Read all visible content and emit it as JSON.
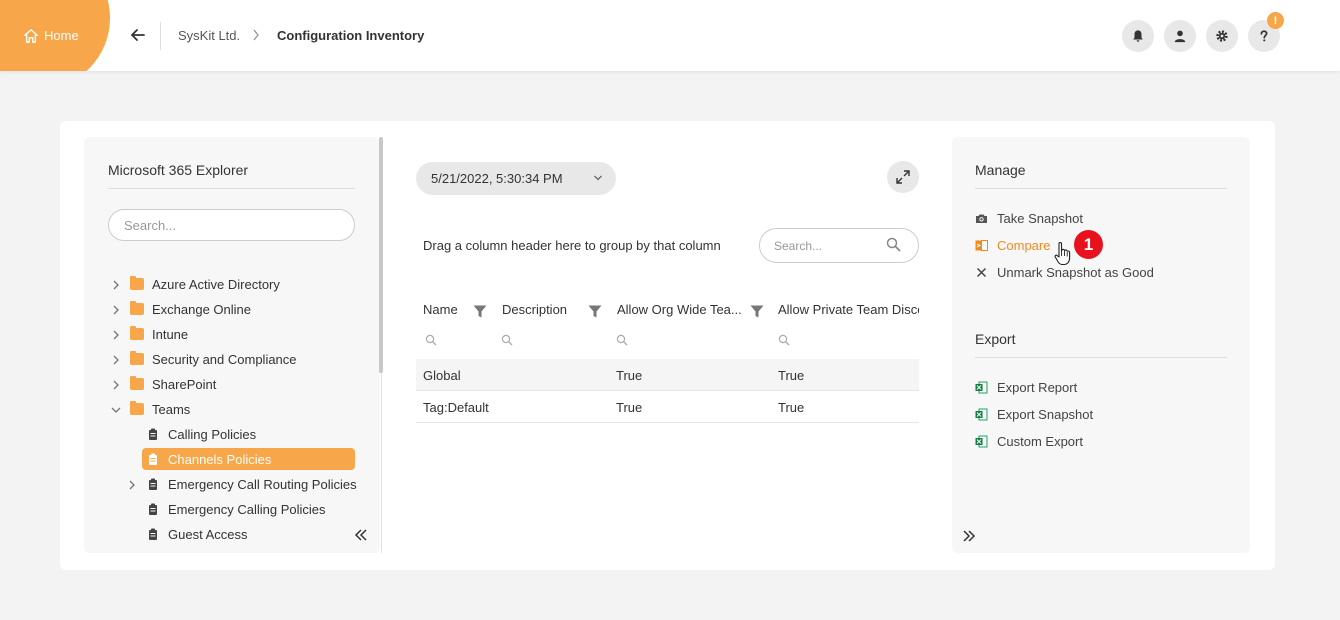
{
  "topbar": {
    "home_label": "Home",
    "breadcrumb": [
      "SysKit Ltd.",
      "Configuration Inventory"
    ],
    "help_badge": "!",
    "accent_color": "#f7a64a"
  },
  "left_panel": {
    "title": "Microsoft 365 Explorer",
    "search_placeholder": "Search...",
    "tree": [
      {
        "label": "Azure Active Directory",
        "icon": "folder-icon",
        "expandable": true
      },
      {
        "label": "Exchange Online",
        "icon": "folder-icon",
        "expandable": true
      },
      {
        "label": "Intune",
        "icon": "folder-icon",
        "expandable": true
      },
      {
        "label": "Security and Compliance",
        "icon": "folder-icon",
        "expandable": true
      },
      {
        "label": "SharePoint",
        "icon": "folder-icon",
        "expandable": true
      },
      {
        "label": "Teams",
        "icon": "folder-icon",
        "expanded": true
      },
      {
        "label": "Calling Policies",
        "icon": "clipboard-icon"
      },
      {
        "label": "Channels Policies",
        "icon": "clipboard-icon",
        "selected": true
      },
      {
        "label": "Emergency Call Routing Policies",
        "icon": "clipboard-icon",
        "expandable": true
      },
      {
        "label": "Emergency Calling Policies",
        "icon": "clipboard-icon"
      },
      {
        "label": "Guest Access",
        "icon": "clipboard-icon"
      }
    ]
  },
  "center": {
    "snapshot_date": "5/21/2022, 5:30:34 PM",
    "group_hint": "Drag a column header here to group by that column",
    "search_placeholder": "Search...",
    "columns": [
      "Name",
      "Description",
      "Allow Org Wide Tea...",
      "Allow Private Team Disco"
    ],
    "rows": [
      [
        "Global",
        "",
        "True",
        "True"
      ],
      [
        "Tag:Default",
        "",
        "True",
        "True"
      ]
    ]
  },
  "right_panel": {
    "manage_title": "Manage",
    "manage_items": [
      "Take Snapshot",
      "Compare",
      "Unmark Snapshot as Good"
    ],
    "export_title": "Export",
    "export_items": [
      "Export Report",
      "Export Snapshot",
      "Custom Export"
    ],
    "step_number": "1",
    "active_color": "#f08a1d"
  }
}
